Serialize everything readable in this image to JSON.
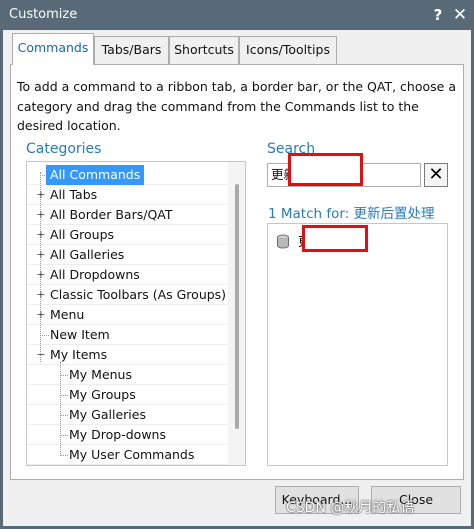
{
  "window": {
    "title": "Customize",
    "help_label": "?",
    "close_label": "✕"
  },
  "tabs": [
    {
      "label": "Commands",
      "active": true
    },
    {
      "label": "Tabs/Bars"
    },
    {
      "label": "Shortcuts"
    },
    {
      "label": "Icons/Tooltips"
    }
  ],
  "instructions": "To add a command to a ribbon tab, a border bar, or the QAT, choose a category and drag the command from the Commands list to the desired location.",
  "categories": {
    "label": "Categories",
    "items": [
      {
        "label": "All Commands",
        "expander": "",
        "selected": true
      },
      {
        "label": "All Tabs",
        "expander": "+"
      },
      {
        "label": "All Border Bars/QAT",
        "expander": "+"
      },
      {
        "label": "All Groups",
        "expander": "+"
      },
      {
        "label": "All Galleries",
        "expander": "+"
      },
      {
        "label": "All Dropdowns",
        "expander": "+"
      },
      {
        "label": "Classic Toolbars (As Groups)",
        "expander": "+"
      },
      {
        "label": "Menu",
        "expander": "+"
      },
      {
        "label": "New Item",
        "expander": ""
      },
      {
        "label": "My Items",
        "expander": "−"
      },
      {
        "label": "My Menus",
        "expander": ""
      },
      {
        "label": "My Groups",
        "expander": ""
      },
      {
        "label": "My Galleries",
        "expander": ""
      },
      {
        "label": "My Drop-downs",
        "expander": ""
      },
      {
        "label": "My User Commands",
        "expander": ""
      }
    ]
  },
  "search": {
    "label": "Search",
    "value": "更新",
    "clear_label": "✕",
    "match_text": "1 Match for: 更新后置处理",
    "results": [
      {
        "label": "更",
        "icon": "command-icon"
      }
    ]
  },
  "buttons": {
    "keyboard": "Keyboard...",
    "close": "Close"
  },
  "watermark": "CSDN @秋月的私语",
  "colors": {
    "accent": "#2a7ab9",
    "selection": "#3399ff",
    "titlebar": "#586a78",
    "redaction": "#e01010"
  }
}
